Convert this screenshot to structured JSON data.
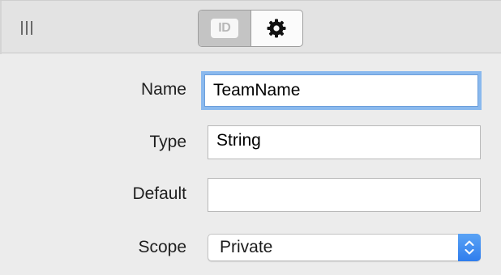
{
  "toolbar": {
    "segments": [
      {
        "icon": "id-card-icon",
        "text": "ID",
        "selected": true
      },
      {
        "icon": "gear-icon",
        "selected": false
      }
    ]
  },
  "form": {
    "name": {
      "label": "Name",
      "value": "TeamName"
    },
    "type": {
      "label": "Type",
      "value": "String"
    },
    "default": {
      "label": "Default",
      "value": ""
    },
    "scope": {
      "label": "Scope",
      "value": "Private"
    }
  },
  "colors": {
    "focus_ring": "#8ab9ee",
    "stepper": "#2f7ded",
    "selected_segment": "#c4c4c4"
  }
}
